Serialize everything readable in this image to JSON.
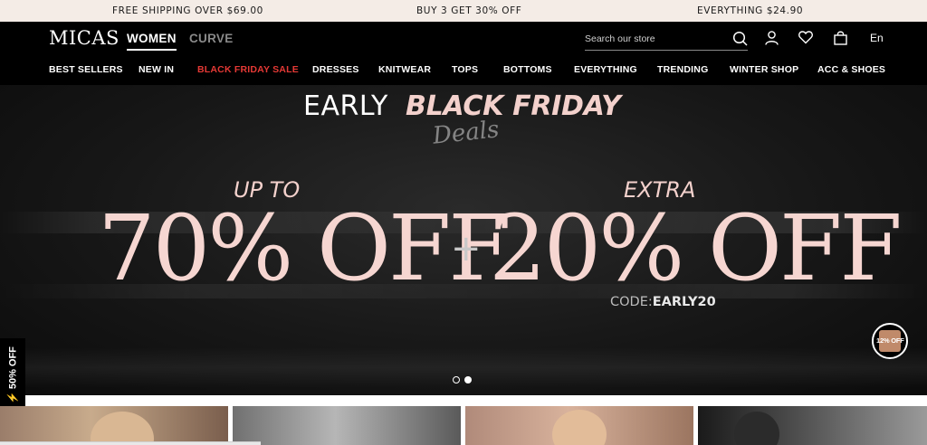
{
  "announcement": {
    "items": [
      "FREE SHIPPING OVER $69.00",
      "BUY 3 GET 30% OFF",
      "EVERYTHING $24.90"
    ]
  },
  "header": {
    "logo": "MICAS",
    "segments": {
      "women": "WOMEN",
      "curve": "CURVE"
    },
    "search_placeholder": "Search our store",
    "language": "En"
  },
  "nav": {
    "items": [
      "BEST SELLERS",
      "NEW IN",
      "BLACK FRIDAY SALE",
      "DRESSES",
      "KNITWEAR",
      "TOPS",
      "BOTTOMS",
      "EVERYTHING",
      "TRENDING",
      "WINTER SHOP",
      "ACC & SHOES"
    ]
  },
  "hero": {
    "title_early": "EARLY",
    "title_bf": "BLACK FRIDAY",
    "deals": "Deals",
    "upto": "UP TO",
    "left_offer": "70% OFF",
    "plus": "+",
    "extra": "EXTRA",
    "right_offer": "20% OFF",
    "code_label": "CODE:",
    "code_value": "EARLY20",
    "carousel_active": 2,
    "carousel_total": 2
  },
  "promo_badge": "12% OFF",
  "side_tab": "⚡ 50% OFF",
  "colors": {
    "announcement_bg": "#f4ece6",
    "header_bg": "#000000",
    "sale_red": "#e53935",
    "hero_pink": "#f6d6d1"
  }
}
